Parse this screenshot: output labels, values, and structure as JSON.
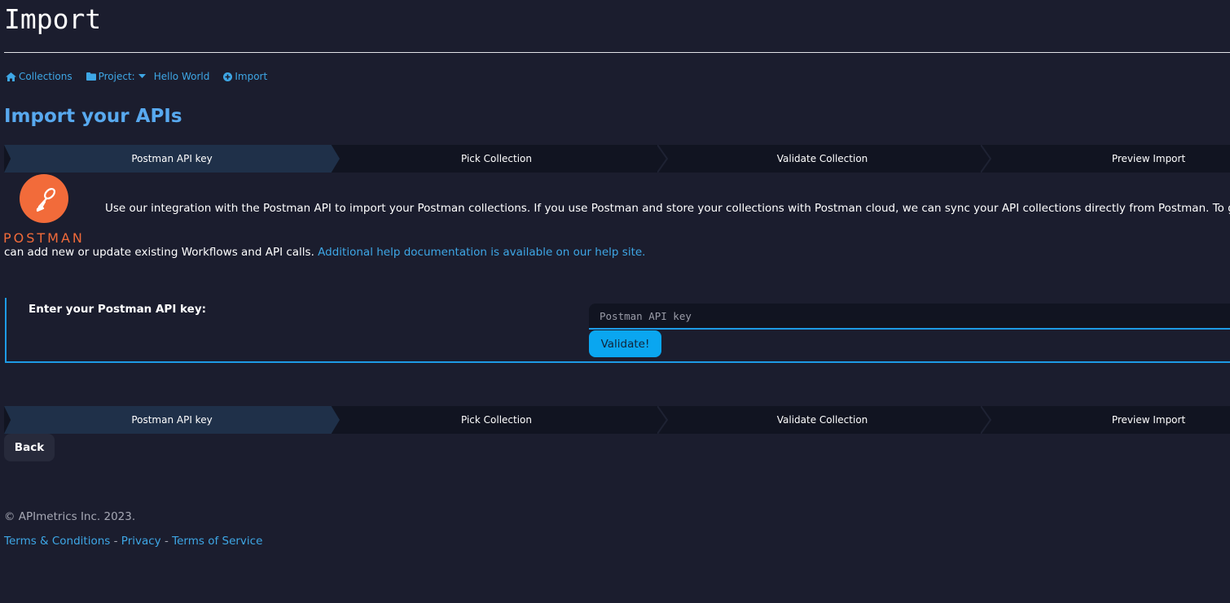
{
  "header": {
    "title": "Import"
  },
  "breadcrumb": {
    "collections_label": "Collections",
    "project_label": "Project:",
    "project_name": "Hello World",
    "import_label": "Import"
  },
  "main": {
    "heading": "Import your APIs",
    "steps": [
      "Postman API key",
      "Pick Collection",
      "Validate Collection",
      "Preview Import"
    ],
    "active_step": 0,
    "logo_text": "POSTMAN",
    "intro_line1": "Use our integration with the Postman API to import your Postman collections. If you use Postman and store your collections with Postman cloud, we can sync your API collections directly from Postman. To get start",
    "intro_line2": "can add new or update existing Workflows and API calls.",
    "help_link": "Additional help documentation is available on our help site.",
    "key_label": "Enter your Postman API key:",
    "key_placeholder": "Postman API key",
    "key_value": "",
    "validate_label": "Validate!",
    "back_label": "Back"
  },
  "footer": {
    "copyright": "© APImetrics Inc. 2023.",
    "links": [
      "Terms & Conditions",
      "Privacy",
      "Terms of Service"
    ],
    "separator": " - "
  },
  "colors": {
    "background": "#1b1d2e",
    "accent": "#3ea7e6",
    "heading": "#58a9ef",
    "postman_orange": "#f26b3a",
    "validate_button": "#0aa6f0",
    "active_step": "#1f3049"
  },
  "icons": {
    "collections": "home-icon",
    "project": "folder-icon",
    "project_dropdown": "caret-down-icon",
    "import": "plus-circle-icon",
    "logo": "postman-logo-icon"
  }
}
